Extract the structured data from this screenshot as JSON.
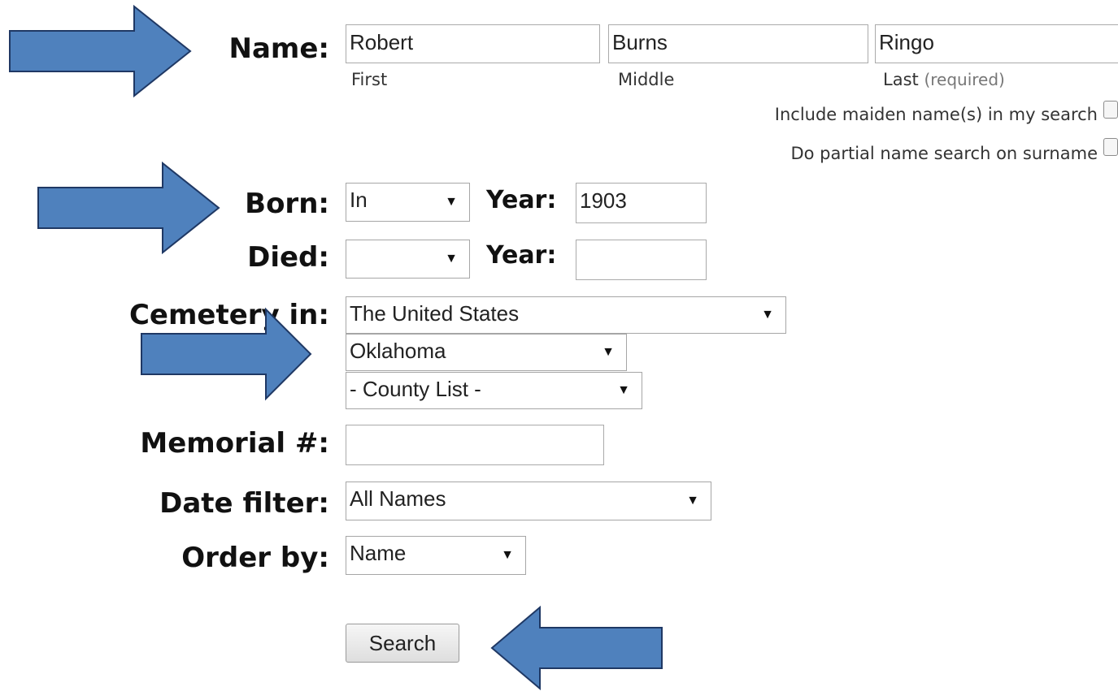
{
  "name": {
    "label": "Name:",
    "first": {
      "value": "Robert",
      "caption": "First"
    },
    "middle": {
      "value": "Burns",
      "caption": "Middle"
    },
    "last": {
      "value": "Ringo",
      "caption": "Last",
      "caption_note": "(required)"
    },
    "maiden_option": "Include maiden name(s) in my search",
    "partial_option": "Do partial name search on surname"
  },
  "born": {
    "label": "Born:",
    "qualifier": "In",
    "year_label": "Year:",
    "year": "1903"
  },
  "died": {
    "label": "Died:",
    "qualifier": "",
    "year_label": "Year:",
    "year": ""
  },
  "cemetery": {
    "label": "Cemetery in:",
    "country": "The United States",
    "state": "Oklahoma",
    "county": "- County List -"
  },
  "memorial": {
    "label": "Memorial #:",
    "value": ""
  },
  "date_filter": {
    "label": "Date filter:",
    "value": "All Names"
  },
  "order_by": {
    "label": "Order by:",
    "value": "Name"
  },
  "search_button": "Search",
  "colors": {
    "arrow_fill": "#4f81bd",
    "arrow_stroke": "#1f3864"
  },
  "annotations": [
    "right-arrow",
    "right-arrow",
    "right-arrow",
    "left-arrow"
  ]
}
